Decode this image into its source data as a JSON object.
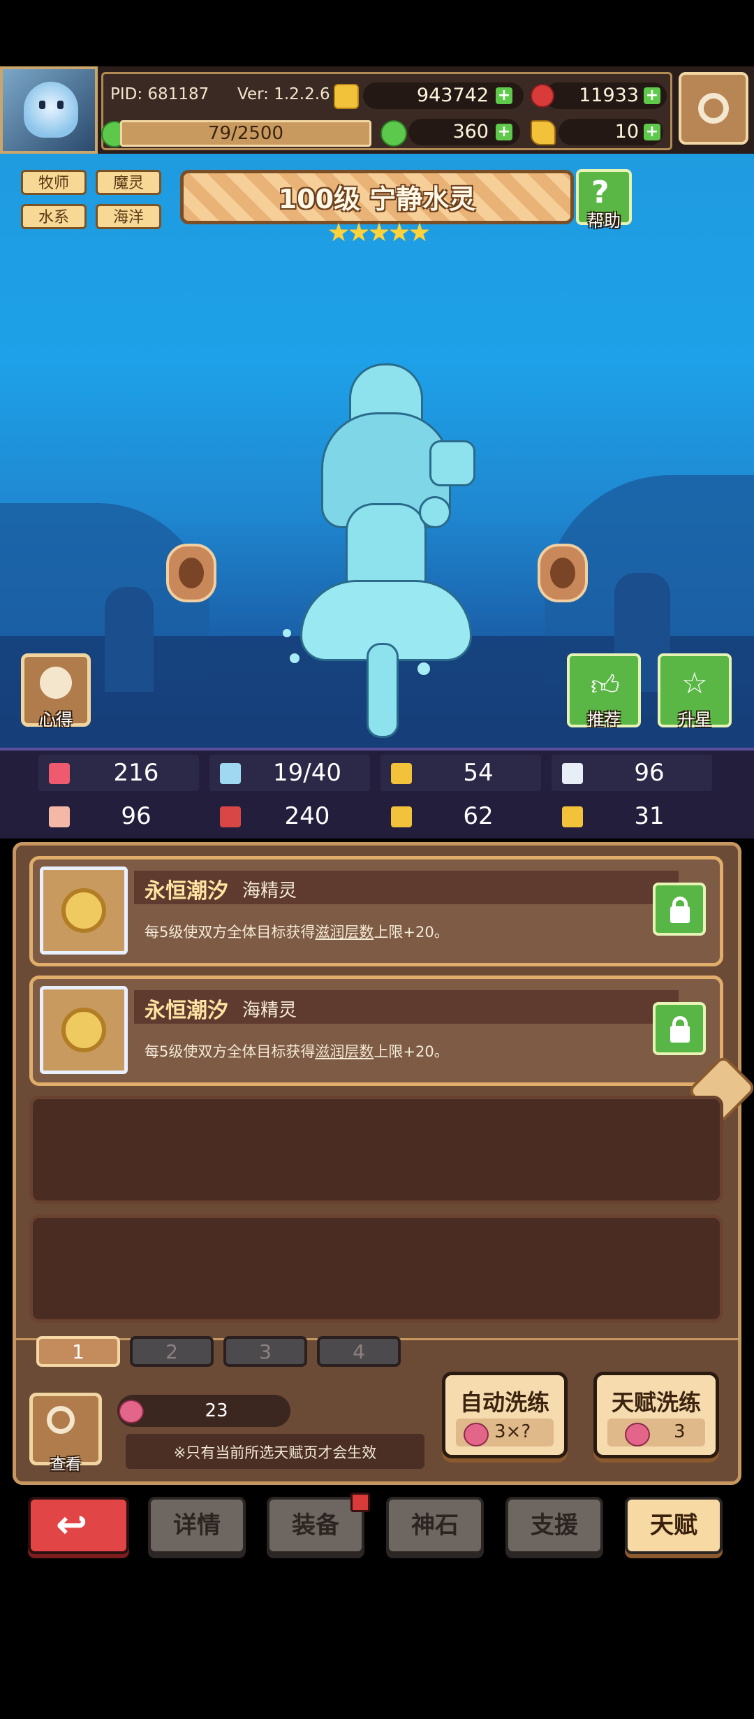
{
  "header": {
    "pid": "PID: 681187",
    "version": "Ver: 1.2.2.6",
    "gold": "943742",
    "gems": "11933",
    "xp": "79/2500",
    "clovers": "360",
    "tokens": "10"
  },
  "tags": [
    "牧师",
    "魔灵",
    "水系",
    "海洋"
  ],
  "character": {
    "title": "100级  宁静水灵",
    "stars": 5
  },
  "buttons": {
    "help": "帮助",
    "notes": "心得",
    "recommend": "推荐",
    "star_up": "升星"
  },
  "stats": [
    {
      "icon": "heart-icon",
      "value": "216",
      "color": "#f05a6e"
    },
    {
      "icon": "mana-drop-icon",
      "value": "19/40",
      "color": "#9fd8f0"
    },
    {
      "icon": "shield-icon",
      "value": "54",
      "color": "#f2c23a"
    },
    {
      "icon": "wing-icon",
      "value": "96",
      "color": "#e8eef6"
    },
    {
      "icon": "fist-icon",
      "value": "96",
      "color": "#f4b8a6"
    },
    {
      "icon": "spellbook-icon",
      "value": "240",
      "color": "#d94646"
    },
    {
      "icon": "scroll-icon",
      "value": "62",
      "color": "#f2c23a"
    },
    {
      "icon": "magnet-icon",
      "value": "31",
      "color": "#f2c23a"
    }
  ],
  "talents": [
    {
      "name": "永恒潮汐",
      "type": "海精灵",
      "desc_prefix": "每5级使双方全体目标获得",
      "desc_link": "滋润层数",
      "desc_suffix": "上限+20。"
    },
    {
      "name": "永恒潮汐",
      "type": "海精灵",
      "desc_prefix": "每5级使双方全体目标获得",
      "desc_link": "滋润层数",
      "desc_suffix": "上限+20。"
    }
  ],
  "pages": [
    "1",
    "2",
    "3",
    "4"
  ],
  "bottom_panel": {
    "view_label": "查看",
    "peach_count": "23",
    "note": "※只有当前所选天赋页才会生效",
    "auto_reroll_label": "自动洗练",
    "auto_reroll_cost": "3×?",
    "talent_reroll_label": "天赋洗练",
    "talent_reroll_cost": "3"
  },
  "nav": {
    "details": "详情",
    "equipment": "装备",
    "god_stone": "神石",
    "support": "支援",
    "talent": "天赋"
  }
}
